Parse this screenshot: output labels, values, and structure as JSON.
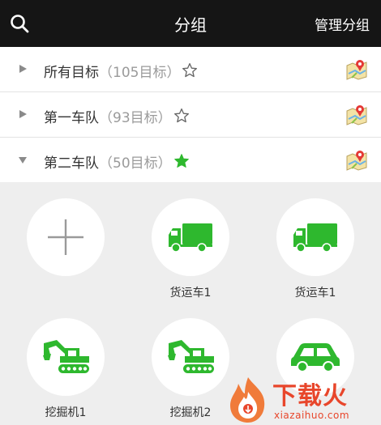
{
  "header": {
    "title": "分组",
    "manage_label": "管理分组"
  },
  "groups": [
    {
      "name": "所有目标",
      "count": "（105目标）",
      "starred": false,
      "expanded": false
    },
    {
      "name": "第一车队",
      "count": "（93目标）",
      "starred": false,
      "expanded": false
    },
    {
      "name": "第二车队",
      "count": "（50目标）",
      "starred": true,
      "expanded": true
    }
  ],
  "vehicles": [
    {
      "label": "",
      "icon": "add-icon"
    },
    {
      "label": "货运车1",
      "icon": "truck-icon"
    },
    {
      "label": "货运车1",
      "icon": "truck-icon"
    },
    {
      "label": "挖掘机1",
      "icon": "excavator-icon"
    },
    {
      "label": "挖掘机2",
      "icon": "excavator-icon"
    },
    {
      "label": "",
      "icon": "car-icon"
    }
  ],
  "watermark": {
    "text": "下载火",
    "url": "xiazaihuo.com"
  },
  "colors": {
    "accent_green": "#2eb82e",
    "header_bg": "#151515",
    "watermark_red": "#e8462b"
  }
}
